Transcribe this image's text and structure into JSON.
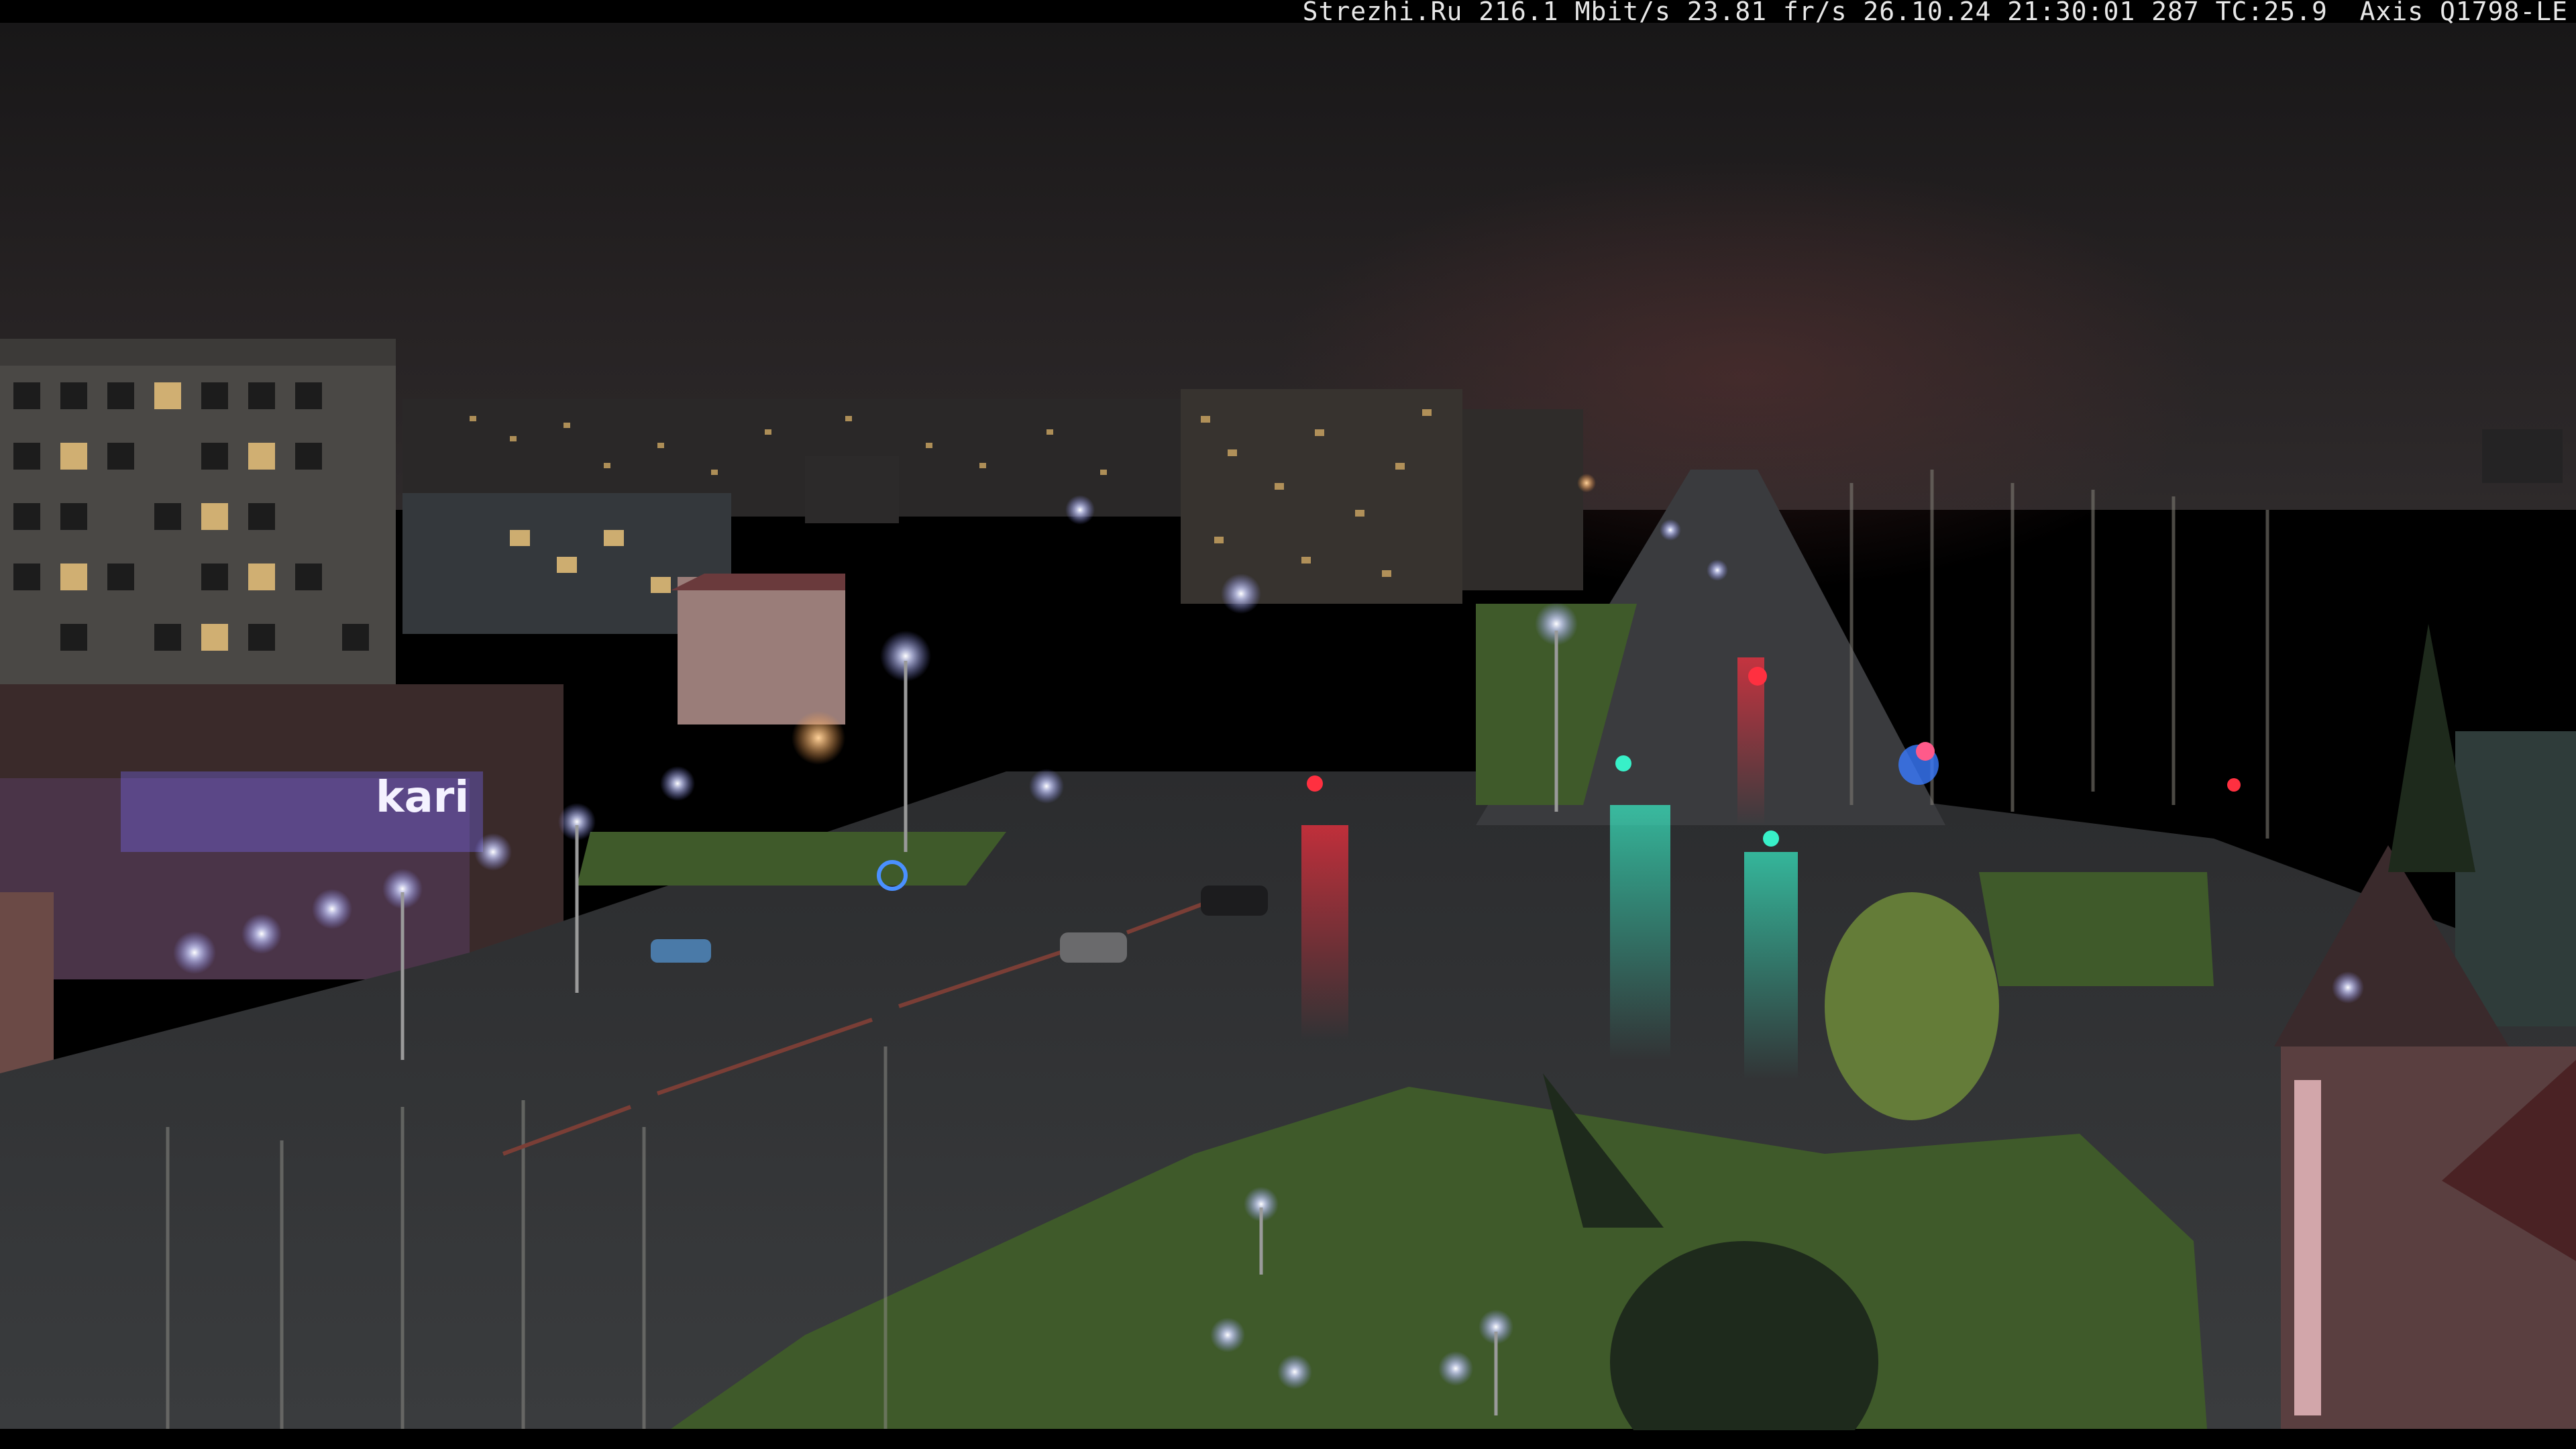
{
  "overlay": {
    "camera_info": "Strezhi.Ru 216.1 Mbit/s 23.81 fr/s 26.10.24 21:30:01 287 TC:25.9  Axis Q1798-LE"
  },
  "store_sign": {
    "brand": "kari"
  },
  "colors": {
    "sky": "#1c1a1c",
    "asphalt": "#2e3033",
    "grass": "#3f5a2a",
    "sign_glow": "#7a6cff",
    "traffic_green": "#38f0c8",
    "traffic_red": "#ff3040"
  }
}
